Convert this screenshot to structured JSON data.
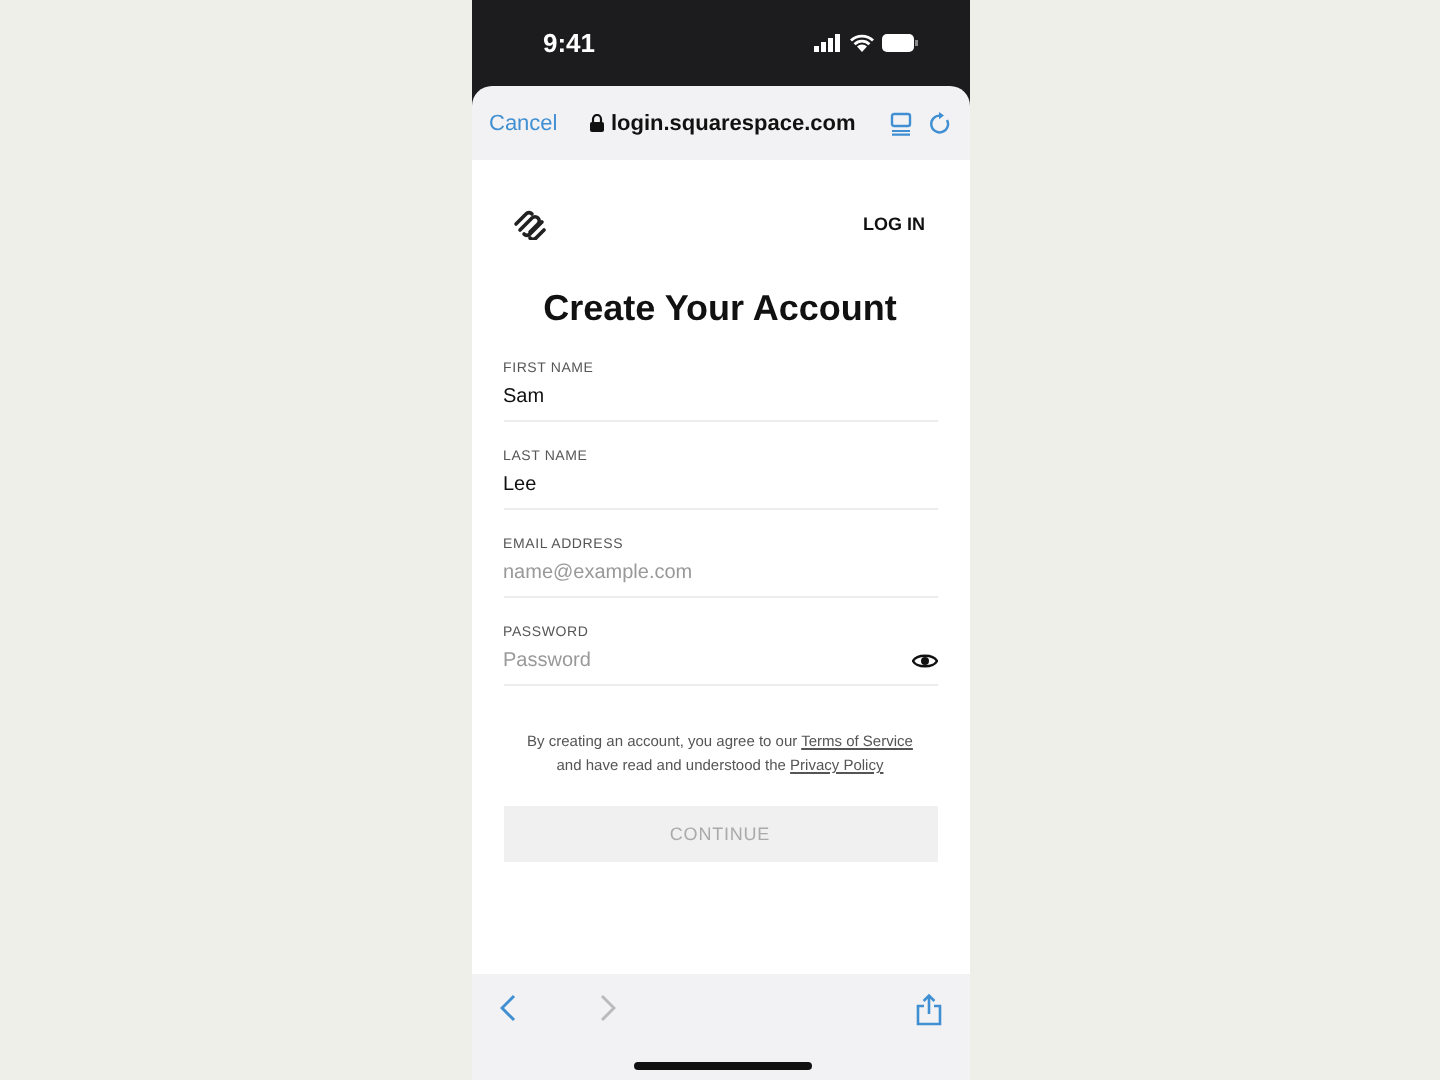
{
  "status_bar": {
    "time": "9:41"
  },
  "browser_bar": {
    "cancel": "Cancel",
    "url": "login.squarespace.com"
  },
  "header": {
    "login_link": "LOG IN"
  },
  "title": "Create Your Account",
  "fields": [
    {
      "kind": "text",
      "label": "FIRST NAME",
      "value": "Sam"
    },
    {
      "kind": "text",
      "label": "LAST NAME",
      "value": "Lee"
    },
    {
      "kind": "text",
      "label": "EMAIL ADDRESS",
      "placeholder": "name@example.com"
    },
    {
      "kind": "password",
      "label": "PASSWORD",
      "placeholder": "Password"
    }
  ],
  "legal": {
    "before": "By creating an account, you agree to our",
    "link_1": "Terms of Service",
    "middle": "and have read and understood the",
    "link_2": "Privacy Policy"
  },
  "continue_button": {
    "label": "CONTINUE",
    "disabled": true
  },
  "toolbar": {
    "back_disabled": false,
    "forward_disabled": true
  }
}
